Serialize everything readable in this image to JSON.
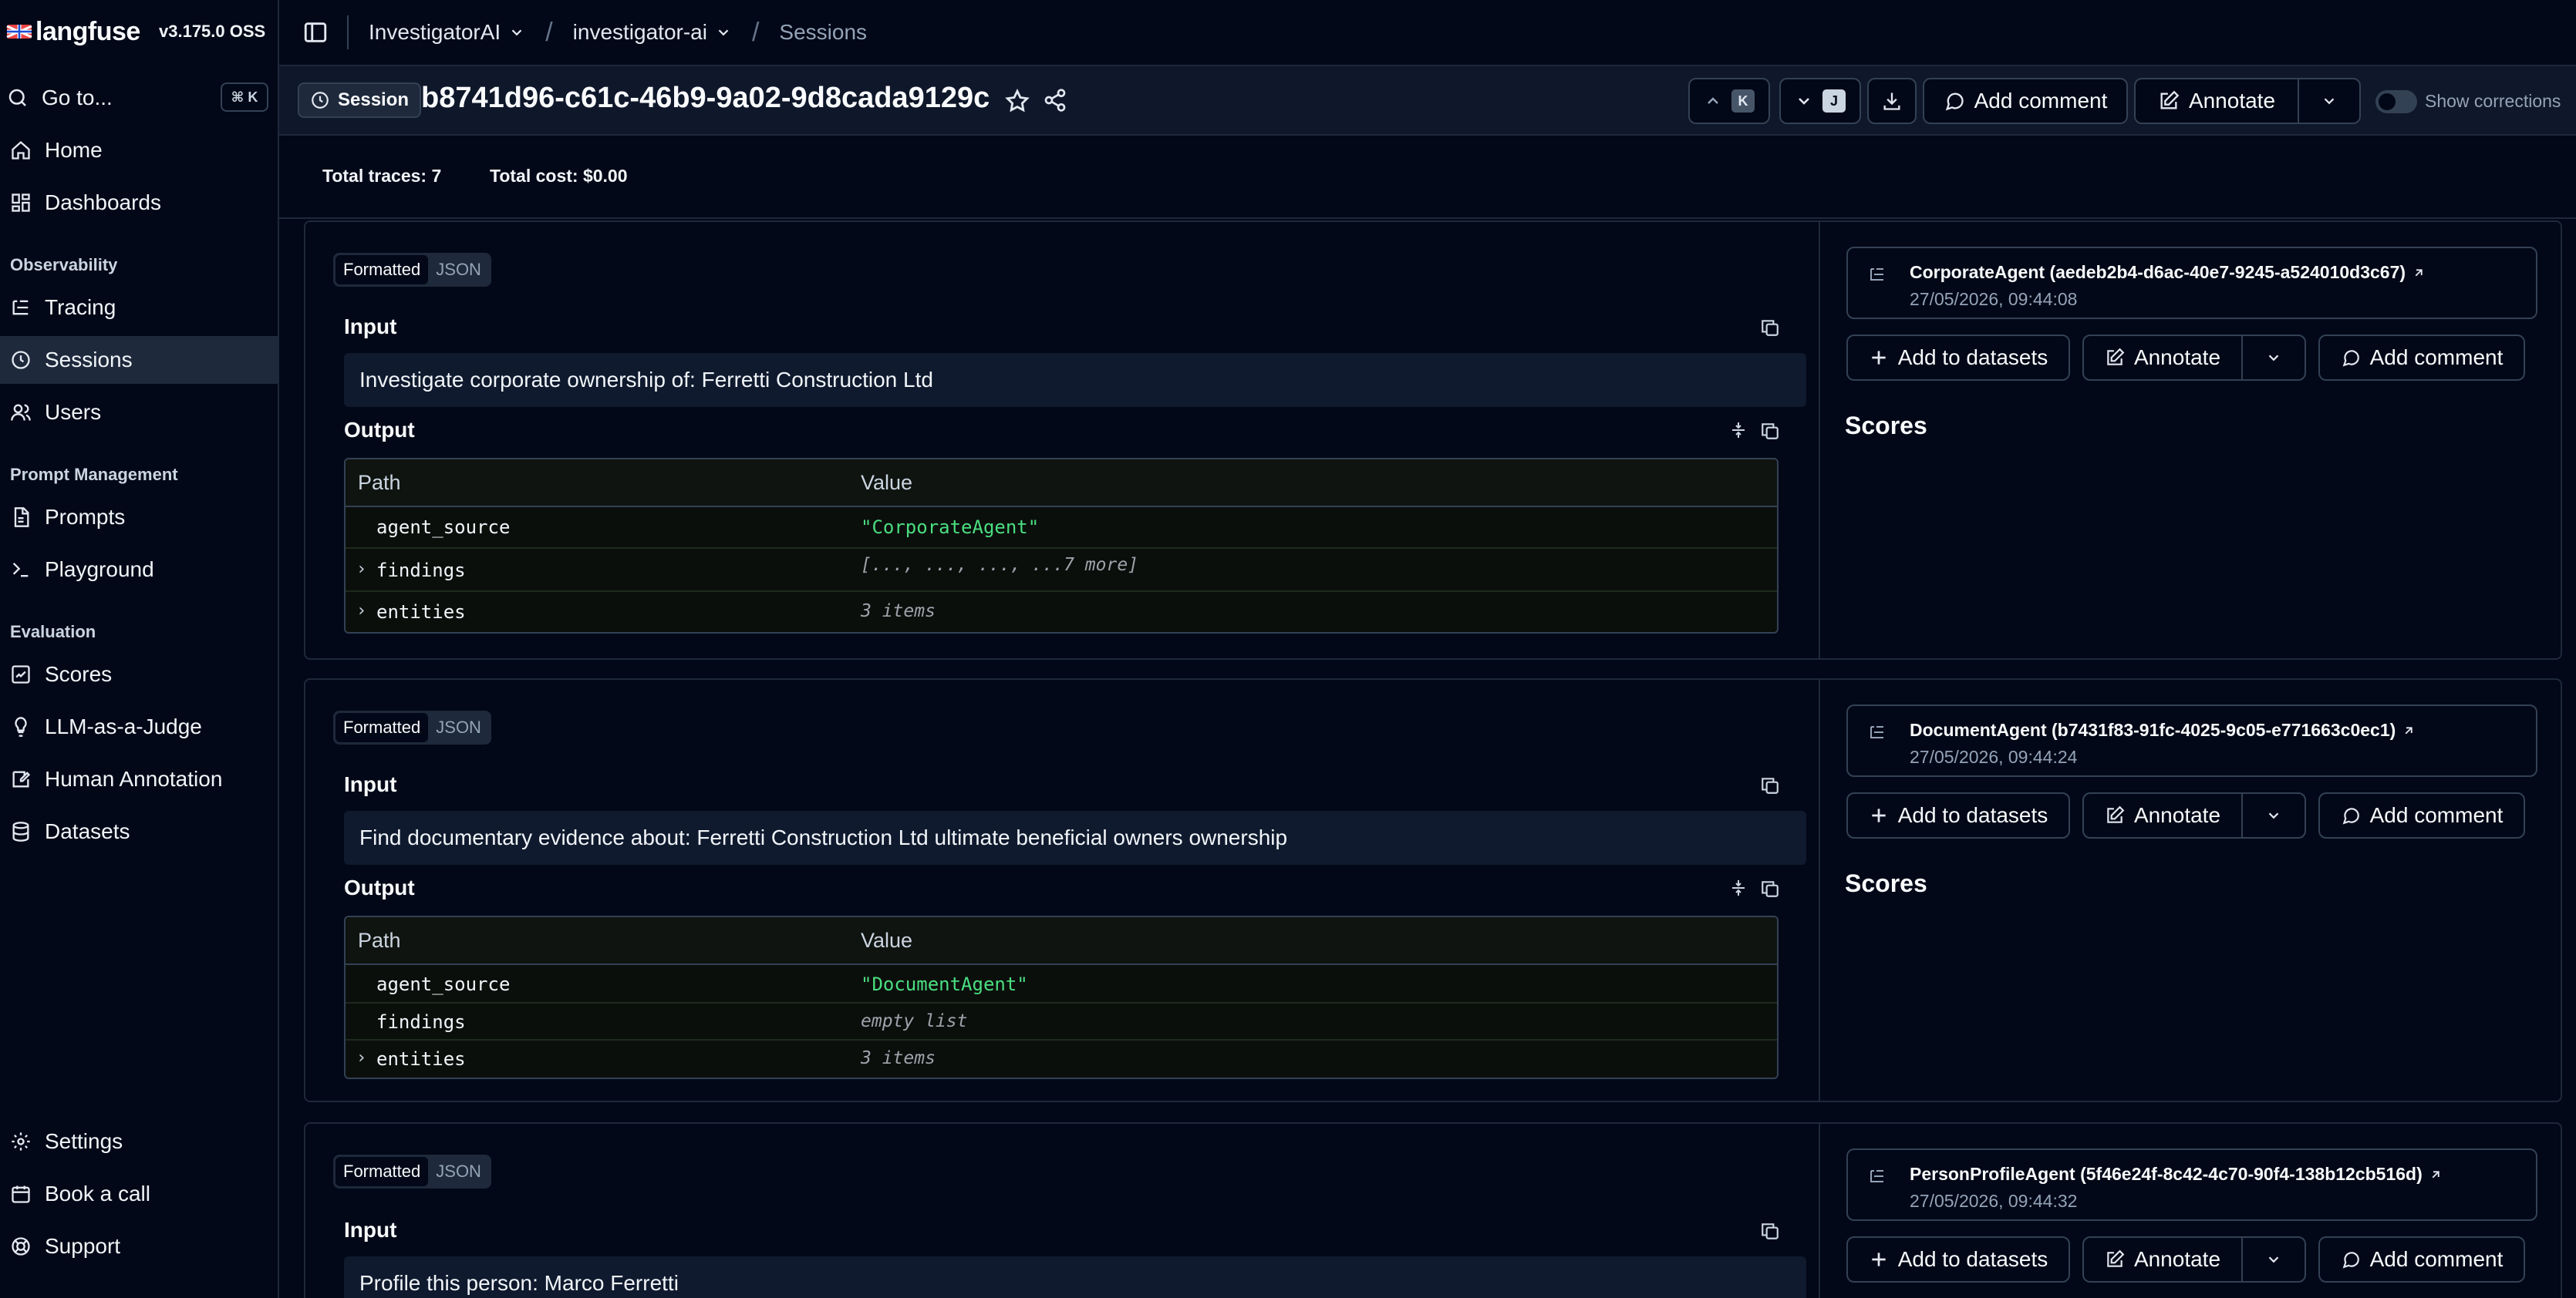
{
  "app": {
    "logo_text": "langfuse",
    "version": "v3.175.0 OSS"
  },
  "sidebar": {
    "goto": {
      "label": "Go to...",
      "shortcut": "⌘ K"
    },
    "top_items": [
      {
        "label": "Home",
        "icon": "home-icon"
      },
      {
        "label": "Dashboards",
        "icon": "dashboard-icon"
      }
    ],
    "sections": [
      {
        "label": "Observability",
        "items": [
          {
            "label": "Tracing",
            "icon": "tracing-icon"
          },
          {
            "label": "Sessions",
            "icon": "clock-icon",
            "active": true
          },
          {
            "label": "Users",
            "icon": "users-icon"
          }
        ]
      },
      {
        "label": "Prompt Management",
        "items": [
          {
            "label": "Prompts",
            "icon": "file-icon"
          },
          {
            "label": "Playground",
            "icon": "terminal-icon"
          }
        ]
      },
      {
        "label": "Evaluation",
        "items": [
          {
            "label": "Scores",
            "icon": "score-icon"
          },
          {
            "label": "LLM-as-a-Judge",
            "icon": "lightbulb-icon"
          },
          {
            "label": "Human Annotation",
            "icon": "annotation-icon"
          },
          {
            "label": "Datasets",
            "icon": "database-icon"
          }
        ]
      }
    ],
    "bottom_items": [
      {
        "label": "Settings",
        "icon": "gear-icon"
      },
      {
        "label": "Book a call",
        "icon": "calendar-icon"
      },
      {
        "label": "Support",
        "icon": "lifebuoy-icon"
      }
    ]
  },
  "topbar": {
    "org": "InvestigatorAI",
    "project": "investigator-ai",
    "page": "Sessions"
  },
  "session": {
    "badge": "Session",
    "id": "b8741d96-c61c-46b9-9a02-9d8cada9129c",
    "prev_key": "K",
    "next_key": "J",
    "add_comment": "Add comment",
    "annotate": "Annotate",
    "show_corrections": "Show corrections"
  },
  "totals": {
    "traces": "Total traces: 7",
    "cost": "Total cost: $0.00"
  },
  "labels": {
    "formatted": "Formatted",
    "json": "JSON",
    "input": "Input",
    "output": "Output",
    "path": "Path",
    "value": "Value",
    "add_to_datasets": "Add to datasets",
    "annotate": "Annotate",
    "add_comment": "Add comment",
    "scores": "Scores"
  },
  "traces": [
    {
      "input": "Investigate corporate ownership of: Ferretti Construction Ltd",
      "rows": [
        {
          "path": "agent_source",
          "value": "\"CorporateAgent\"",
          "kind": "str",
          "expandable": false
        },
        {
          "path": "findings",
          "value": "[..., ..., ..., ...7 more]",
          "kind": "meta",
          "expandable": true
        },
        {
          "path": "entities",
          "value": "3 items",
          "kind": "meta",
          "expandable": true
        }
      ],
      "trace_name": "CorporateAgent (aedeb2b4-d6ac-40e7-9245-a524010d3c67)",
      "timestamp": "27/05/2026, 09:44:08"
    },
    {
      "input": "Find documentary evidence about: Ferretti Construction Ltd ultimate beneficial owners ownership",
      "rows": [
        {
          "path": "agent_source",
          "value": "\"DocumentAgent\"",
          "kind": "str",
          "expandable": false
        },
        {
          "path": "findings",
          "value": "empty list",
          "kind": "meta",
          "expandable": false
        },
        {
          "path": "entities",
          "value": "3 items",
          "kind": "meta",
          "expandable": true
        }
      ],
      "trace_name": "DocumentAgent (b7431f83-91fc-4025-9c05-e771663c0ec1)",
      "timestamp": "27/05/2026, 09:44:24"
    },
    {
      "input": "Profile this person: Marco Ferretti",
      "rows": [],
      "trace_name": "PersonProfileAgent (5f46e24f-8c42-4c70-90f4-138b12cb516d)",
      "timestamp": "27/05/2026, 09:44:32"
    }
  ]
}
